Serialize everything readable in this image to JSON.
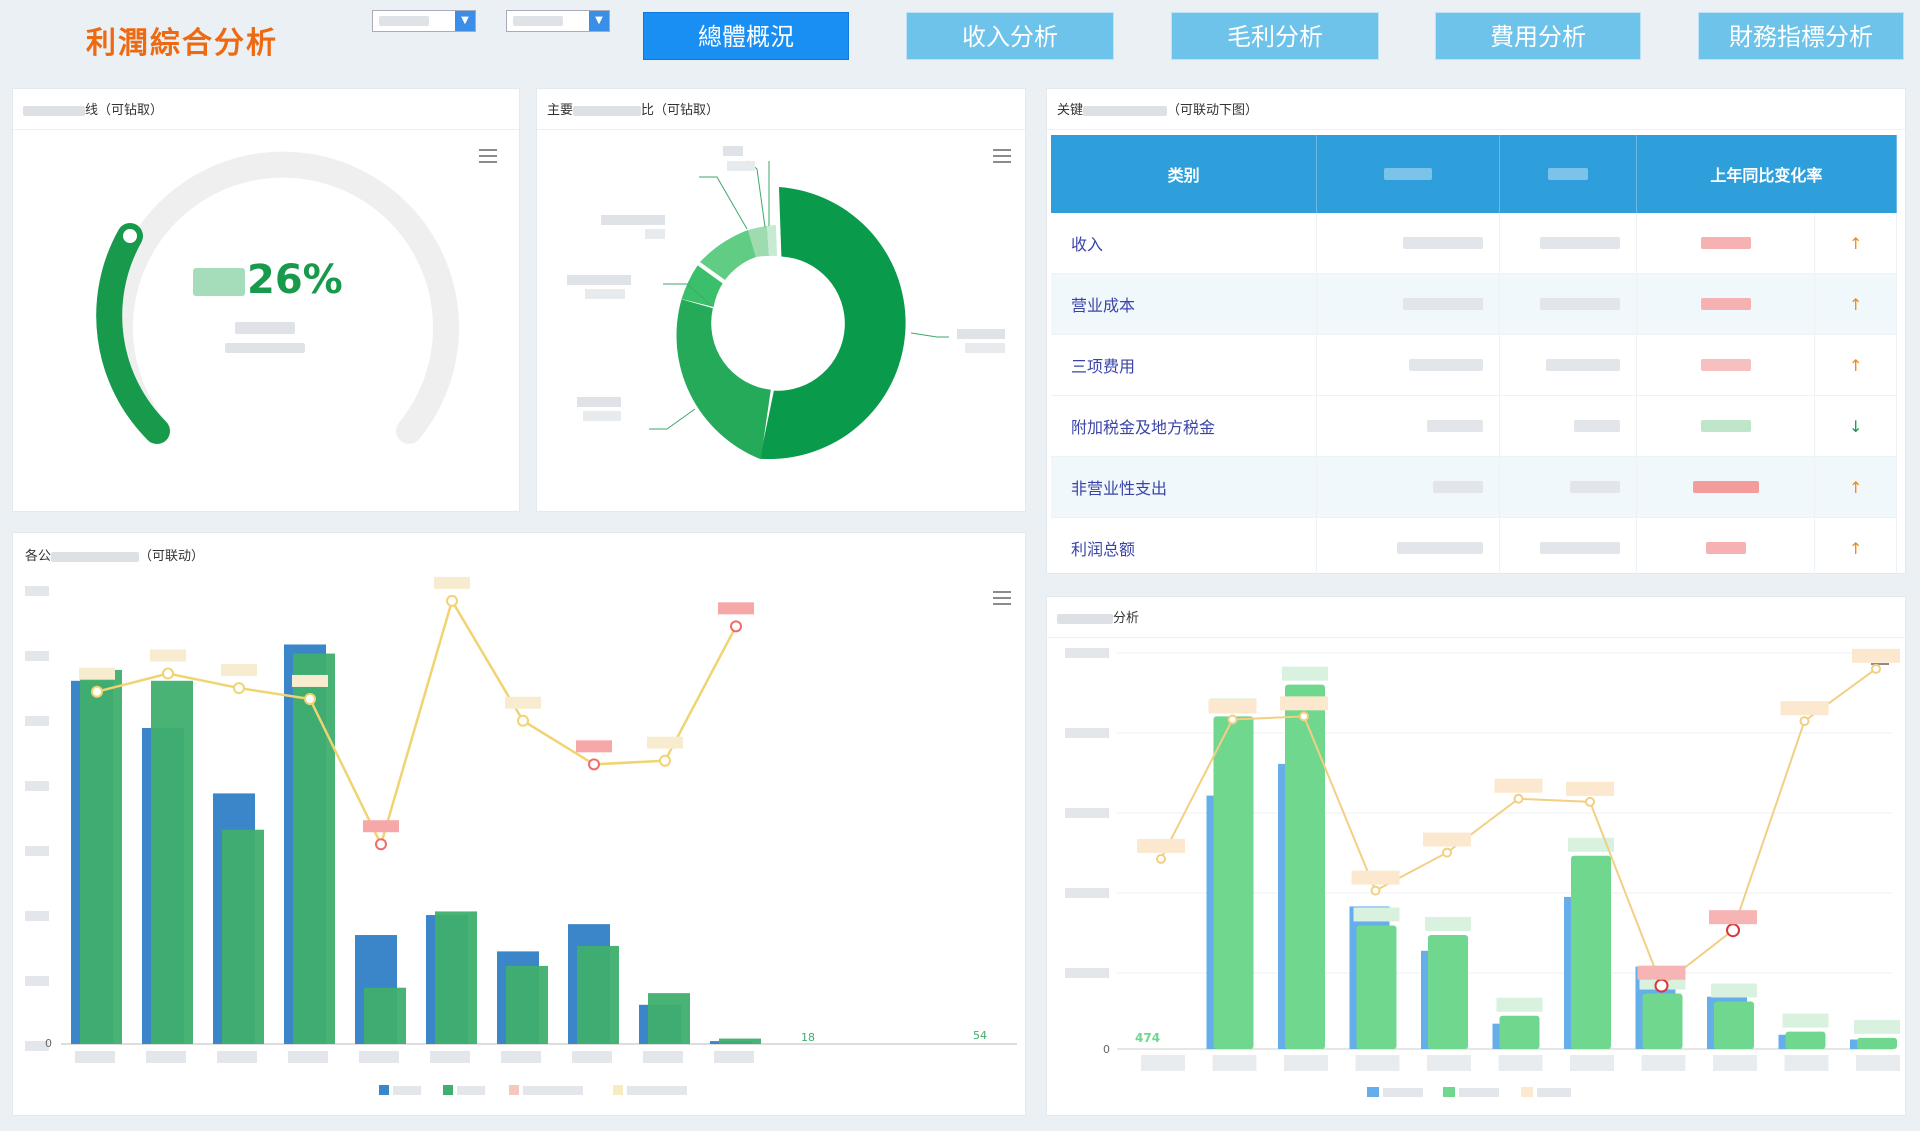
{
  "header": {
    "title": "利潤綜合分析",
    "nav": [
      "總體概況",
      "收入分析",
      "毛利分析",
      "費用分析",
      "財務指標分析"
    ],
    "active_nav": "總體概況"
  },
  "gauge_panel": {
    "title_suffix": "线（可钻取）",
    "value_text": "26%",
    "value_fraction": 0.26,
    "accent": "#189a4d"
  },
  "donut_panel": {
    "title_prefix": "主要",
    "title_suffix": "比（可钻取）"
  },
  "kpi_panel": {
    "title_prefix": "关键",
    "title_suffix": "（可联动下图）",
    "columns": [
      "类别",
      "",
      "",
      "上年同比变化率"
    ],
    "rows": [
      {
        "category": "收入",
        "trend": "↑",
        "trend_dir": "up",
        "rate_color": "#f6b2b2"
      },
      {
        "category": "营业成本",
        "trend": "↑",
        "trend_dir": "up",
        "rate_color": "#f6b2b2"
      },
      {
        "category": "三项费用",
        "trend": "↑",
        "trend_dir": "up",
        "rate_color": "#f6b2b2"
      },
      {
        "category": "附加税金及地方税金",
        "trend": "↓",
        "trend_dir": "down",
        "rate_color": "#bfe6c8"
      },
      {
        "category": "非营业性支出",
        "trend": "↑",
        "trend_dir": "up",
        "rate_color": "#f49c9c"
      },
      {
        "category": "利润总额",
        "trend": "↑",
        "trend_dir": "up",
        "rate_color": "#f6b2b2"
      }
    ]
  },
  "bar_panel": {
    "title_prefix": "各公",
    "title_suffix": "（可联动）",
    "y_ticks": [
      "0"
    ],
    "labels": {
      "low1": "18",
      "low2": "54"
    }
  },
  "right_chart_panel": {
    "title_suffix": "分析",
    "y_ticks": [
      "0"
    ],
    "first_label": "474"
  },
  "chart_data": [
    {
      "type": "bar",
      "series": [
        {
          "values": [
            1000,
            870,
            690,
            1100,
            300,
            355,
            255,
            330,
            108,
            8
          ]
        },
        {
          "values": [
            1030,
            1000,
            590,
            1075,
            155,
            365,
            215,
            270,
            140,
            15
          ]
        },
        {
          "values": [
            970,
            1020,
            980,
            950,
            550,
            1220,
            890,
            770,
            780,
            1150
          ]
        }
      ]
    },
    {
      "type": "bar",
      "series": [
        {
          "values": [
            0,
            1600,
            1800,
            900,
            620,
            160,
            960,
            520,
            330,
            90,
            60
          ]
        },
        {
          "values": [
            0,
            2100,
            2300,
            780,
            720,
            210,
            1220,
            350,
            300,
            110,
            70
          ]
        },
        {
          "values": [
            1200,
            2080,
            2100,
            1000,
            1240,
            1580,
            1560,
            400,
            750,
            2070,
            2400
          ]
        }
      ]
    }
  ]
}
